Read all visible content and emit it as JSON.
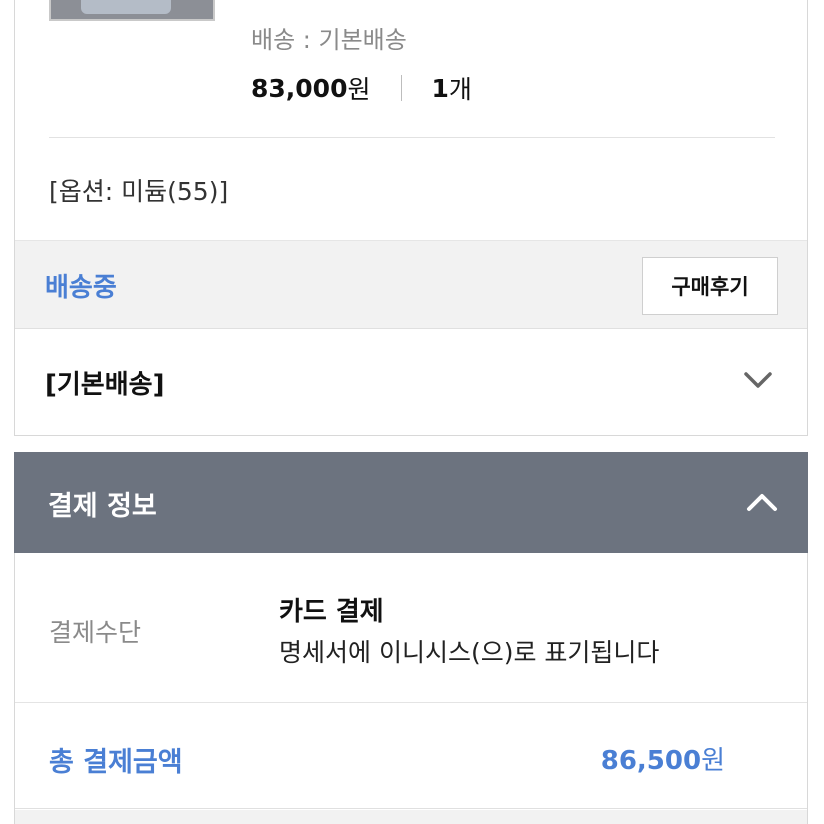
{
  "order": {
    "shipping_line": "배송 : 기본배송",
    "price": "83,000",
    "price_unit": "원",
    "qty": "1",
    "qty_unit": "개",
    "option": "[옵션: 미듐(55)]",
    "status": "배송중",
    "review_button": "구매후기",
    "shipping_section": "[기본배송]"
  },
  "payment": {
    "header": "결제 정보",
    "method_label": "결제수단",
    "method_name": "카드 결제",
    "method_note": "명세서에 이니시스(으)로 표기됩니다",
    "total_label": "총 결제금액",
    "total_value": "86,500",
    "total_unit": "원"
  },
  "icons": {
    "shipping_toggle": "chevron-down-icon",
    "payment_toggle": "chevron-up-icon"
  },
  "colors": {
    "accent": "#4a7fd4",
    "header_bg": "#6c737f"
  }
}
